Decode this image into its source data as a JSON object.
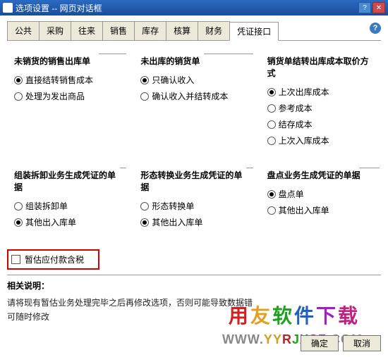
{
  "window": {
    "title": "选项设置 -- 网页对话框"
  },
  "tabs": [
    {
      "label": "公共"
    },
    {
      "label": "采购"
    },
    {
      "label": "往来"
    },
    {
      "label": "销售"
    },
    {
      "label": "库存"
    },
    {
      "label": "核算"
    },
    {
      "label": "财务"
    },
    {
      "label": "凭证接口"
    }
  ],
  "groups": {
    "g1": {
      "legend": "未销货的销售出库单",
      "options": [
        {
          "label": "直接结转销售成本",
          "checked": true
        },
        {
          "label": "处理为发出商品",
          "checked": false
        }
      ]
    },
    "g2": {
      "legend": "未出库的销货单",
      "options": [
        {
          "label": "只确认收入",
          "checked": true
        },
        {
          "label": "确认收入并结转成本",
          "checked": false
        }
      ]
    },
    "g3": {
      "legend": "销货单结转出库成本取价方式",
      "options": [
        {
          "label": "上次出库成本",
          "checked": true
        },
        {
          "label": "参考成本",
          "checked": false
        },
        {
          "label": "结存成本",
          "checked": false
        },
        {
          "label": "上次入库成本",
          "checked": false
        }
      ]
    },
    "g4": {
      "legend": "组装拆卸业务生成凭证的单据",
      "options": [
        {
          "label": "组装拆卸单",
          "checked": false
        },
        {
          "label": "其他出入库单",
          "checked": true
        }
      ]
    },
    "g5": {
      "legend": "形态转换业务生成凭证的单据",
      "options": [
        {
          "label": "形态转换单",
          "checked": false
        },
        {
          "label": "其他出入库单",
          "checked": true
        }
      ]
    },
    "g6": {
      "legend": "盘点业务生成凭证的单据",
      "options": [
        {
          "label": "盘点单",
          "checked": true
        },
        {
          "label": "其他出入库单",
          "checked": false
        }
      ]
    }
  },
  "tax_checkbox": {
    "label": "暂估应付款含税",
    "checked": false
  },
  "related": {
    "header": "相关说明：",
    "line1": "请将现有暂估业务处理完毕之后再修改选项，否则可能导致数据错",
    "line2": "可随时修改"
  },
  "footer": {
    "ok": "确定",
    "cancel": "取消"
  },
  "watermark": {
    "text": "用友软件下载",
    "url": "WWW.YYRJXSZ.COM"
  }
}
